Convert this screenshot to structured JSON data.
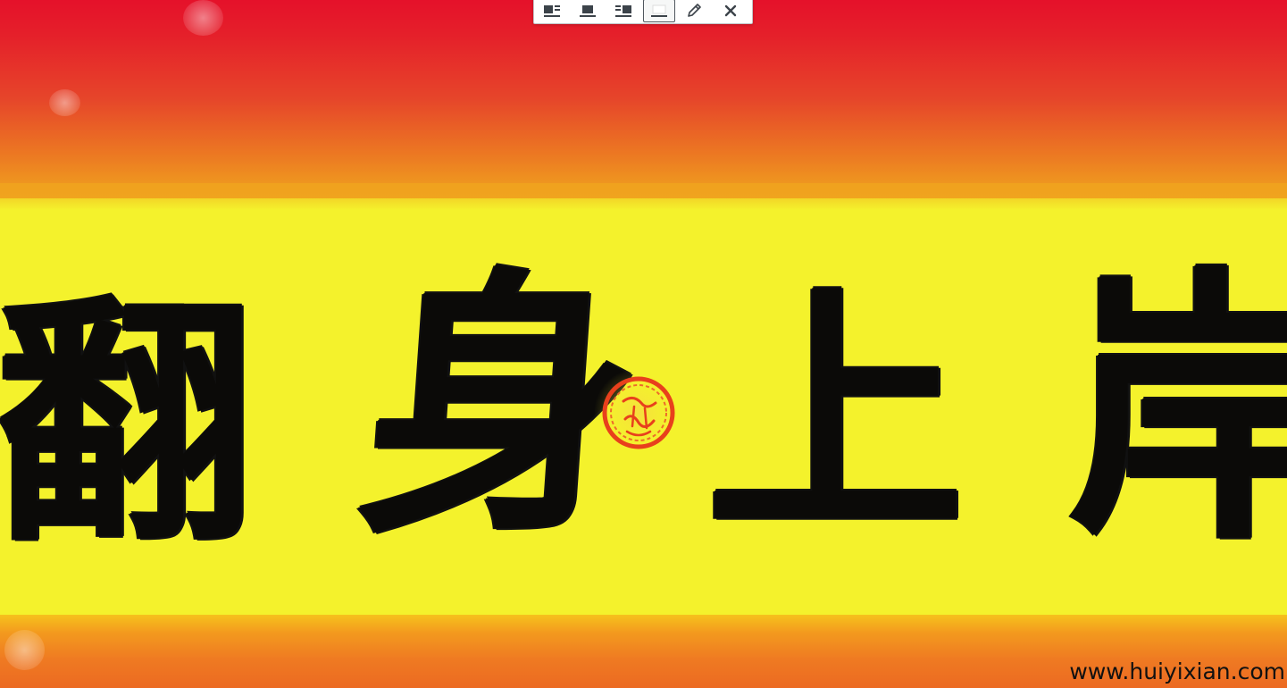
{
  "toolbar": {
    "buttons": [
      {
        "name": "align-left",
        "icon": "align-left-icon",
        "active": false
      },
      {
        "name": "align-center",
        "icon": "align-center-icon",
        "active": false
      },
      {
        "name": "align-right",
        "icon": "align-right-icon",
        "active": false
      },
      {
        "name": "align-none",
        "icon": "align-none-icon",
        "active": true
      },
      {
        "name": "edit",
        "icon": "pencil-icon",
        "active": false
      },
      {
        "name": "remove",
        "icon": "close-icon",
        "active": false
      }
    ]
  },
  "banner": {
    "characters": [
      "翻",
      "身",
      "上",
      "岸"
    ],
    "seal_color": "#e8401c",
    "colors": {
      "top": "#e5112a",
      "middle": "#f4f22c",
      "bottom": "#ec6a22",
      "ink": "#0b0a08"
    }
  },
  "watermark": {
    "text": "www.huiyixian.com"
  }
}
